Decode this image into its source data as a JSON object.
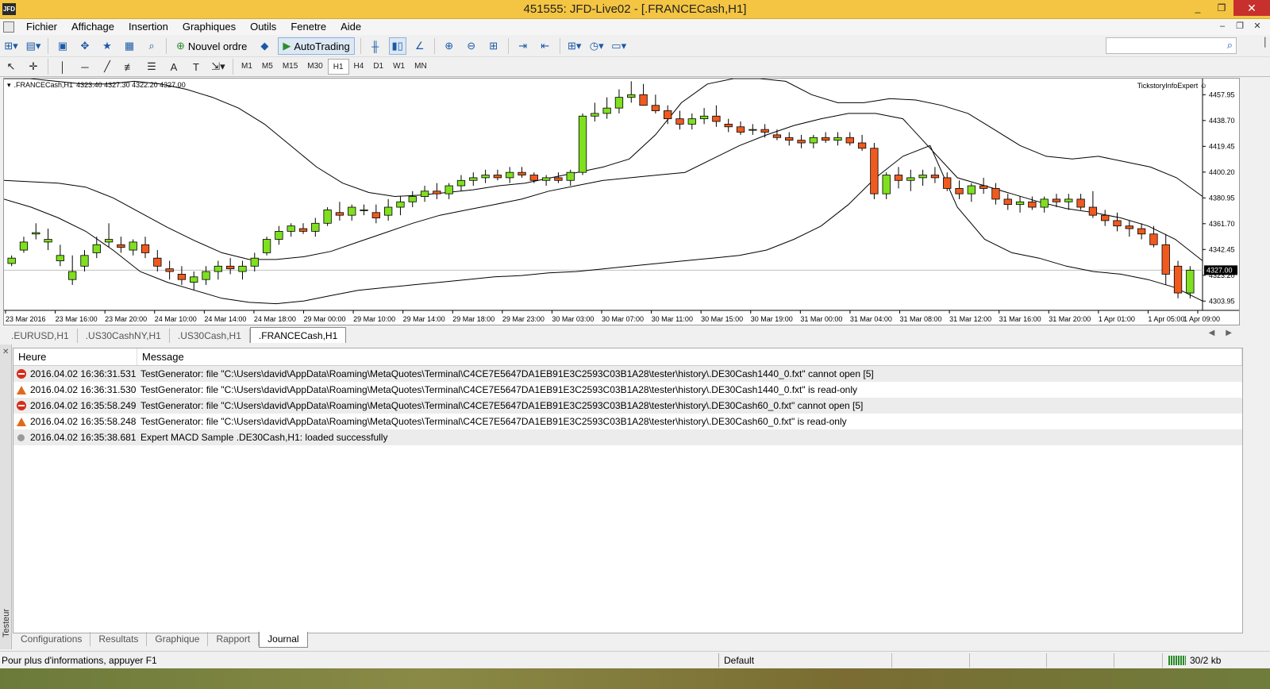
{
  "window": {
    "title": "451555: JFD-Live02 - [.FRANCECash,H1]",
    "app_icon": "JFD",
    "minimize": "_",
    "restore": "❐",
    "close": "✕"
  },
  "menu": [
    "Fichier",
    "Affichage",
    "Insertion",
    "Graphiques",
    "Outils",
    "Fenetre",
    "Aide"
  ],
  "toolbar": {
    "new_order": "Nouvel ordre",
    "autotrading": "AutoTrading"
  },
  "timeframes": [
    "M1",
    "M5",
    "M15",
    "M30",
    "H1",
    "H4",
    "D1",
    "W1",
    "MN"
  ],
  "active_timeframe": "H1",
  "chart": {
    "symbol": ".FRANCECash,H1",
    "ohlc": "4323.40 4327.30 4322.20 4327.00",
    "expert": "TickstoryInfoExpert",
    "price_labels": [
      "4457.95",
      "4438.70",
      "4419.45",
      "4400.20",
      "4380.95",
      "4361.70",
      "4342.45",
      "4323.20",
      "4303.95"
    ],
    "current_price": "4327.00",
    "time_labels": [
      "23 Mar 2016",
      "23 Mar 16:00",
      "23 Mar 20:00",
      "24 Mar 10:00",
      "24 Mar 14:00",
      "24 Mar 18:00",
      "29 Mar 00:00",
      "29 Mar 10:00",
      "29 Mar 14:00",
      "29 Mar 18:00",
      "29 Mar 23:00",
      "30 Mar 03:00",
      "30 Mar 07:00",
      "30 Mar 11:00",
      "30 Mar 15:00",
      "30 Mar 19:00",
      "31 Mar 00:00",
      "31 Mar 04:00",
      "31 Mar 08:00",
      "31 Mar 12:00",
      "31 Mar 16:00",
      "31 Mar 20:00",
      "1 Apr 01:00",
      "1 Apr 05:00",
      "1 Apr 09:00"
    ],
    "up_color": "#7fe01f",
    "down_color": "#f05a1e"
  },
  "chart_data": {
    "type": "candlestick",
    "ylim": [
      4297,
      4470
    ],
    "candles": [
      [
        4332,
        4338,
        4330,
        4336
      ],
      [
        4342,
        4352,
        4340,
        4348
      ],
      [
        4354,
        4362,
        4350,
        4355
      ],
      [
        4348,
        4358,
        4342,
        4350
      ],
      [
        4334,
        4346,
        4330,
        4338
      ],
      [
        4320,
        4338,
        4316,
        4326
      ],
      [
        4330,
        4342,
        4326,
        4338
      ],
      [
        4340,
        4352,
        4336,
        4346
      ],
      [
        4348,
        4362,
        4344,
        4350
      ],
      [
        4346,
        4352,
        4340,
        4344
      ],
      [
        4342,
        4350,
        4338,
        4348
      ],
      [
        4346,
        4352,
        4336,
        4340
      ],
      [
        4336,
        4342,
        4326,
        4330
      ],
      [
        4328,
        4334,
        4320,
        4326
      ],
      [
        4324,
        4330,
        4316,
        4320
      ],
      [
        4318,
        4326,
        4312,
        4322
      ],
      [
        4320,
        4330,
        4316,
        4326
      ],
      [
        4326,
        4334,
        4320,
        4330
      ],
      [
        4330,
        4336,
        4324,
        4328
      ],
      [
        4326,
        4334,
        4320,
        4330
      ],
      [
        4330,
        4340,
        4326,
        4336
      ],
      [
        4340,
        4352,
        4338,
        4350
      ],
      [
        4350,
        4360,
        4346,
        4356
      ],
      [
        4356,
        4362,
        4352,
        4360
      ],
      [
        4358,
        4362,
        4354,
        4356
      ],
      [
        4356,
        4366,
        4352,
        4362
      ],
      [
        4362,
        4374,
        4360,
        4372
      ],
      [
        4370,
        4378,
        4364,
        4368
      ],
      [
        4368,
        4376,
        4364,
        4374
      ],
      [
        4372,
        4376,
        4368,
        4372
      ],
      [
        4370,
        4376,
        4362,
        4366
      ],
      [
        4368,
        4380,
        4364,
        4374
      ],
      [
        4374,
        4382,
        4368,
        4378
      ],
      [
        4378,
        4386,
        4374,
        4382
      ],
      [
        4382,
        4390,
        4378,
        4386
      ],
      [
        4386,
        4392,
        4380,
        4384
      ],
      [
        4384,
        4392,
        4380,
        4390
      ],
      [
        4390,
        4398,
        4386,
        4394
      ],
      [
        4394,
        4400,
        4390,
        4396
      ],
      [
        4396,
        4402,
        4392,
        4398
      ],
      [
        4398,
        4402,
        4394,
        4396
      ],
      [
        4396,
        4404,
        4392,
        4400
      ],
      [
        4400,
        4404,
        4396,
        4398
      ],
      [
        4398,
        4400,
        4392,
        4394
      ],
      [
        4394,
        4398,
        4390,
        4396
      ],
      [
        4396,
        4400,
        4392,
        4394
      ],
      [
        4394,
        4402,
        4390,
        4400
      ],
      [
        4400,
        4444,
        4398,
        4442
      ],
      [
        4442,
        4452,
        4438,
        4444
      ],
      [
        4444,
        4456,
        4440,
        4448
      ],
      [
        4448,
        4462,
        4444,
        4456
      ],
      [
        4456,
        4468,
        4452,
        4458
      ],
      [
        4458,
        4466,
        4452,
        4450
      ],
      [
        4450,
        4458,
        4444,
        4446
      ],
      [
        4446,
        4450,
        4436,
        4440
      ],
      [
        4440,
        4446,
        4432,
        4436
      ],
      [
        4436,
        4444,
        4432,
        4440
      ],
      [
        4440,
        4448,
        4436,
        4442
      ],
      [
        4442,
        4450,
        4434,
        4438
      ],
      [
        4436,
        4440,
        4430,
        4434
      ],
      [
        4434,
        4438,
        4428,
        4430
      ],
      [
        4432,
        4436,
        4428,
        4432
      ],
      [
        4432,
        4436,
        4426,
        4430
      ],
      [
        4428,
        4432,
        4424,
        4426
      ],
      [
        4426,
        4430,
        4420,
        4424
      ],
      [
        4424,
        4428,
        4418,
        4422
      ],
      [
        4422,
        4428,
        4418,
        4426
      ],
      [
        4426,
        4430,
        4422,
        4424
      ],
      [
        4424,
        4430,
        4420,
        4426
      ],
      [
        4426,
        4430,
        4420,
        4422
      ],
      [
        4422,
        4428,
        4416,
        4418
      ],
      [
        4418,
        4422,
        4380,
        4384
      ],
      [
        4384,
        4400,
        4380,
        4398
      ],
      [
        4398,
        4404,
        4388,
        4394
      ],
      [
        4394,
        4402,
        4386,
        4396
      ],
      [
        4396,
        4402,
        4390,
        4398
      ],
      [
        4398,
        4404,
        4392,
        4396
      ],
      [
        4396,
        4400,
        4386,
        4388
      ],
      [
        4388,
        4394,
        4380,
        4384
      ],
      [
        4384,
        4392,
        4378,
        4390
      ],
      [
        4390,
        4396,
        4384,
        4388
      ],
      [
        4388,
        4392,
        4376,
        4380
      ],
      [
        4380,
        4384,
        4372,
        4376
      ],
      [
        4376,
        4382,
        4370,
        4378
      ],
      [
        4378,
        4382,
        4372,
        4374
      ],
      [
        4374,
        4382,
        4370,
        4380
      ],
      [
        4380,
        4384,
        4374,
        4378
      ],
      [
        4378,
        4384,
        4372,
        4380
      ],
      [
        4380,
        4384,
        4372,
        4374
      ],
      [
        4374,
        4386,
        4366,
        4368
      ],
      [
        4368,
        4372,
        4360,
        4364
      ],
      [
        4364,
        4370,
        4356,
        4360
      ],
      [
        4360,
        4364,
        4352,
        4358
      ],
      [
        4358,
        4362,
        4350,
        4354
      ],
      [
        4354,
        4360,
        4344,
        4346
      ],
      [
        4346,
        4354,
        4316,
        4324
      ],
      [
        4330,
        4334,
        4306,
        4310
      ],
      [
        4310,
        4330,
        4306,
        4327
      ]
    ],
    "bands": {
      "upper": [
        4470,
        4470,
        4468,
        4466,
        4466,
        4468,
        4466,
        4462,
        4456,
        4448,
        4436,
        4420,
        4404,
        4392,
        4385,
        4382,
        4383,
        4385,
        4387,
        4390,
        4392,
        4396,
        4400,
        4404,
        4410,
        4428,
        4452,
        4466,
        4470,
        4470,
        4468,
        4458,
        4452,
        4452,
        4455,
        4454,
        4450,
        4444,
        4432,
        4420,
        4412,
        4410,
        4412,
        4408,
        4404,
        4396,
        4382
      ],
      "middle": [
        4394,
        4393,
        4392,
        4389,
        4381,
        4370,
        4359,
        4349,
        4340,
        4335,
        4335,
        4337,
        4341,
        4348,
        4355,
        4362,
        4368,
        4372,
        4376,
        4380,
        4386,
        4390,
        4394,
        4396,
        4398,
        4400,
        4410,
        4420,
        4428,
        4435,
        4440,
        4444,
        4444,
        4440,
        4418,
        4396,
        4390,
        4384,
        4378,
        4373,
        4370,
        4366,
        4360,
        4350,
        4334
      ],
      "lower": [
        4380,
        4374,
        4366,
        4356,
        4342,
        4326,
        4318,
        4312,
        4306,
        4303,
        4302,
        4304,
        4308,
        4312,
        4314,
        4316,
        4318,
        4320,
        4322,
        4323,
        4325,
        4326,
        4328,
        4330,
        4332,
        4334,
        4336,
        4338,
        4342,
        4350,
        4360,
        4376,
        4396,
        4412,
        4420,
        4374,
        4350,
        4340,
        4336,
        4330,
        4326,
        4324,
        4320,
        4314,
        4304
      ]
    }
  },
  "chart_tabs": [
    ".EURUSD,H1",
    ".US30CashNY,H1",
    ".US30Cash,H1",
    ".FRANCECash,H1"
  ],
  "active_chart_tab": 3,
  "journal": {
    "columns": [
      "Heure",
      "Message"
    ],
    "rows": [
      {
        "level": "error",
        "time": "2016.04.02 16:36:31.531",
        "message": "TestGenerator: file \"C:\\Users\\david\\AppData\\Roaming\\MetaQuotes\\Terminal\\C4CE7E5647DA1EB91E3C2593C03B1A28\\tester\\history\\.DE30Cash1440_0.fxt\" cannot open [5]"
      },
      {
        "level": "warning",
        "time": "2016.04.02 16:36:31.530",
        "message": "TestGenerator: file \"C:\\Users\\david\\AppData\\Roaming\\MetaQuotes\\Terminal\\C4CE7E5647DA1EB91E3C2593C03B1A28\\tester\\history\\.DE30Cash1440_0.fxt\" is read-only"
      },
      {
        "level": "error",
        "time": "2016.04.02 16:35:58.249",
        "message": "TestGenerator: file \"C:\\Users\\david\\AppData\\Roaming\\MetaQuotes\\Terminal\\C4CE7E5647DA1EB91E3C2593C03B1A28\\tester\\history\\.DE30Cash60_0.fxt\" cannot open [5]"
      },
      {
        "level": "warning",
        "time": "2016.04.02 16:35:58.248",
        "message": "TestGenerator: file \"C:\\Users\\david\\AppData\\Roaming\\MetaQuotes\\Terminal\\C4CE7E5647DA1EB91E3C2593C03B1A28\\tester\\history\\.DE30Cash60_0.fxt\" is read-only"
      },
      {
        "level": "info",
        "time": "2016.04.02 16:35:38.681",
        "message": "Expert MACD Sample .DE30Cash,H1: loaded successfully"
      }
    ]
  },
  "tester_label": "Testeur",
  "bottom_tabs": [
    "Configurations",
    "Resultats",
    "Graphique",
    "Rapport",
    "Journal"
  ],
  "active_bottom_tab": 4,
  "status": {
    "hint": "Pour plus d'informations, appuyer F1",
    "profile": "Default",
    "connection": "30/2 kb"
  }
}
